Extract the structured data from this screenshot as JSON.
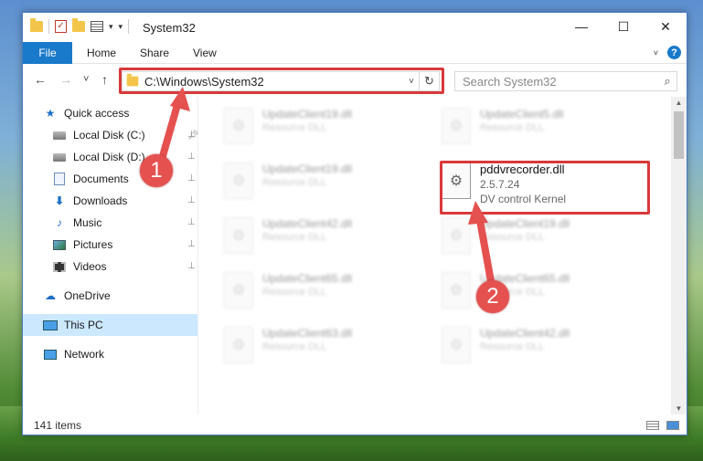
{
  "window": {
    "title": "System32",
    "controls": {
      "minimize": "—",
      "maximize": "☐",
      "close": "✕"
    }
  },
  "ribbon": {
    "tabs": [
      "File",
      "Home",
      "Share",
      "View"
    ],
    "help": "?"
  },
  "nav": {
    "back": "←",
    "forward": "→",
    "recent": "˅",
    "up": "↑",
    "address": "C:\\Windows\\System32",
    "search_placeholder": "Search System32"
  },
  "sidebar": {
    "items": [
      {
        "label": "Quick access",
        "icon": "star-icon",
        "pinned": false
      },
      {
        "label": "Local Disk (C:)",
        "icon": "disk-icon",
        "pinned": true
      },
      {
        "label": "Local Disk (D:)",
        "icon": "disk-icon",
        "pinned": true
      },
      {
        "label": "Documents",
        "icon": "documents-icon",
        "pinned": true
      },
      {
        "label": "Downloads",
        "icon": "downloads-icon",
        "pinned": true
      },
      {
        "label": "Music",
        "icon": "music-icon",
        "pinned": true
      },
      {
        "label": "Pictures",
        "icon": "pictures-icon",
        "pinned": true
      },
      {
        "label": "Videos",
        "icon": "videos-icon",
        "pinned": true
      },
      {
        "label": "OneDrive",
        "icon": "onedrive-icon",
        "pinned": false
      },
      {
        "label": "This PC",
        "icon": "this-pc-icon",
        "pinned": false,
        "selected": true
      },
      {
        "label": "Network",
        "icon": "network-icon",
        "pinned": false
      }
    ]
  },
  "files": [
    {
      "name": "UpdateClient19.dll",
      "meta": "Resource DLL"
    },
    {
      "name": "UpdateClient5.dll",
      "meta": "Resource DLL"
    },
    {
      "name": "UpdateClient19.dll",
      "meta": "Resource DLL"
    },
    {
      "name": "pddvrecorder.dll",
      "version": "2.5.7.24",
      "description": "DV control Kernel"
    },
    {
      "name": "UpdateClient42.dll",
      "meta": "Resource DLL"
    },
    {
      "name": "UpdateClient19.dll",
      "meta": "Resource DLL"
    },
    {
      "name": "UpdateClient65.dll",
      "meta": "Resource DLL"
    },
    {
      "name": "UpdateClient65.dll",
      "meta": "Resource DLL"
    },
    {
      "name": "UpdateClient63.dll",
      "meta": "Resource DLL"
    },
    {
      "name": "UpdateClient42.dll",
      "meta": "Resource DLL"
    }
  ],
  "status": {
    "count": "141 items"
  },
  "annotations": {
    "step1": "1",
    "step2": "2",
    "color": "#e5514f"
  }
}
